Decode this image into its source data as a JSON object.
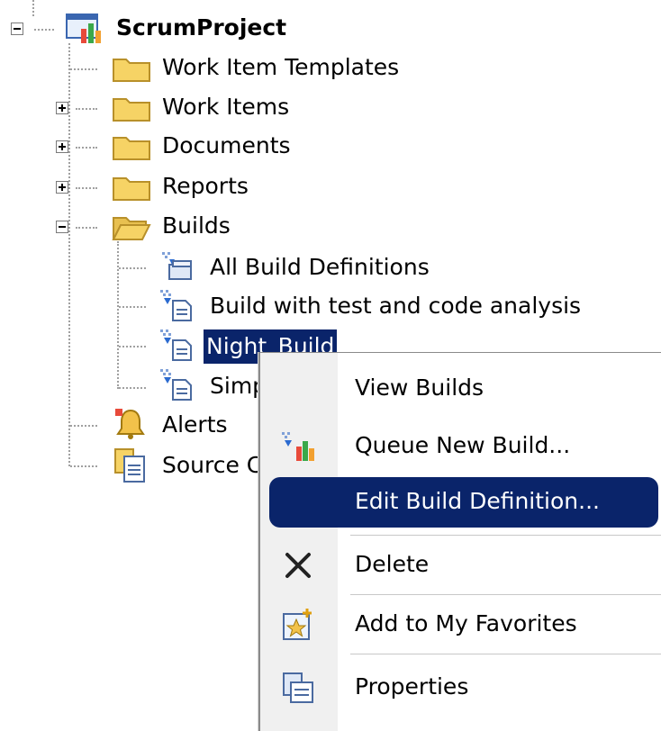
{
  "tree": {
    "root": {
      "label": "ScrumProject",
      "icon": "project-icon"
    },
    "items": [
      {
        "label": "Work Item Templates",
        "icon": "folder-icon",
        "expander": "none"
      },
      {
        "label": "Work Items",
        "icon": "folder-icon",
        "expander": "plus"
      },
      {
        "label": "Documents",
        "icon": "folder-icon",
        "expander": "plus"
      },
      {
        "label": "Reports",
        "icon": "folder-icon",
        "expander": "plus"
      },
      {
        "label": "Builds",
        "icon": "folder-open-icon",
        "expander": "minus",
        "children": [
          {
            "label": "All Build Definitions",
            "icon": "all-builds-icon"
          },
          {
            "label": "Build with test and code analysis",
            "icon": "build-definition-icon"
          },
          {
            "label": "Night_Build",
            "icon": "build-definition-icon",
            "selected": true
          },
          {
            "label": "Simp",
            "icon": "build-definition-icon"
          }
        ]
      },
      {
        "label": "Alerts",
        "icon": "alerts-icon",
        "expander": "none"
      },
      {
        "label": "Source C",
        "icon": "source-control-icon",
        "expander": "none"
      }
    ]
  },
  "context_menu": {
    "items": [
      {
        "label": "View Builds",
        "icon": ""
      },
      {
        "label": "Queue New Build...",
        "icon": "queue-build-icon"
      },
      {
        "label": "Edit Build Definition...",
        "icon": "",
        "highlighted": true
      },
      {
        "label": "Delete",
        "icon": "delete-icon"
      },
      {
        "label": "Add to My Favorites",
        "icon": "favorites-icon"
      },
      {
        "label": "Properties",
        "icon": "properties-icon"
      }
    ]
  },
  "colors": {
    "selection": "#0a246a",
    "menu_gutter": "#f0f0f0",
    "folder": "#f2c94c"
  }
}
